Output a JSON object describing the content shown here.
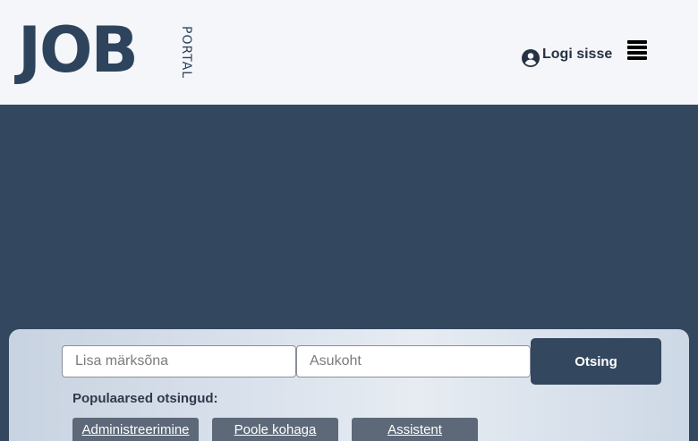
{
  "header": {
    "logo": {
      "main": "JOB",
      "side": "PORTAL"
    },
    "login_label": "Logi sisse",
    "login_icon": "user-circle-icon",
    "menu_icon": "hamburger-menu-icon"
  },
  "search": {
    "keyword_placeholder": "Lisa märksõna",
    "location_placeholder": "Asukoht",
    "button_label": "Otsing",
    "popular_label": "Populaarsed otsingud:",
    "popular": [
      "Administreerimine",
      "Poole kohaga",
      "Assistent"
    ]
  },
  "colors": {
    "brand": "#2e445d",
    "hero": "#33475f",
    "header_bg": "#f4f6fa",
    "chip": "#5d6978"
  }
}
